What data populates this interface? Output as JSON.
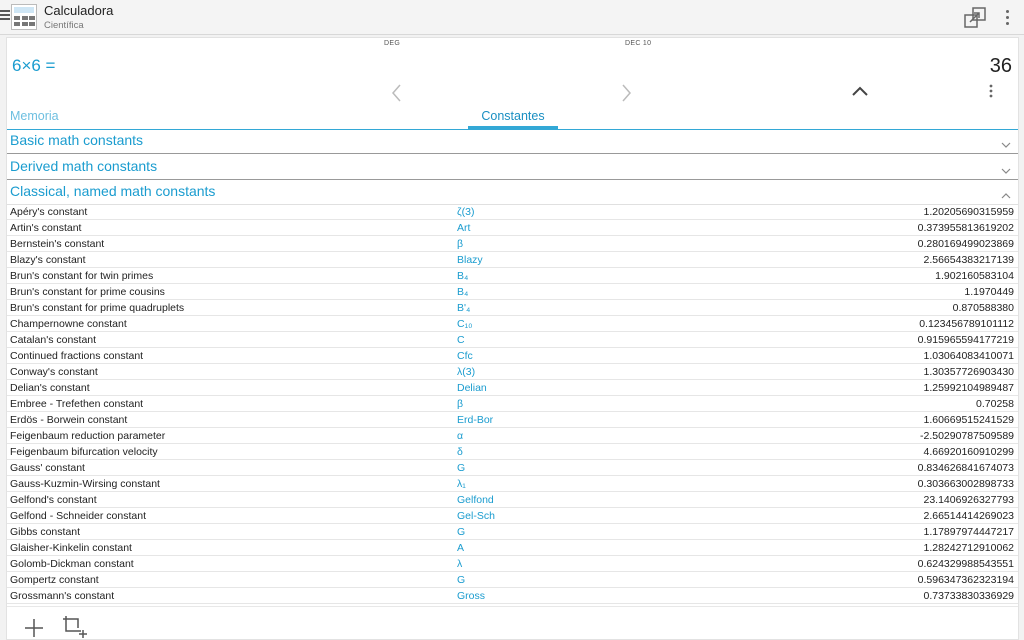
{
  "app": {
    "title": "Calculadora",
    "subtitle": "Científica"
  },
  "status": {
    "mode": "DEG",
    "memory": "DEC 10",
    "left_faint": ""
  },
  "display": {
    "expression": "6×6 =",
    "result": "36"
  },
  "tabs": {
    "memory": "Memoria",
    "constants": "Constantes",
    "active": "Constantes"
  },
  "sections": [
    {
      "label": "Basic math constants",
      "expanded": false
    },
    {
      "label": "Derived math constants",
      "expanded": false
    },
    {
      "label": "Classical, named math constants",
      "expanded": true
    }
  ],
  "constants": [
    {
      "name": "Apéry's constant",
      "symbol": "ζ(3)",
      "value": "1.20205690315959"
    },
    {
      "name": "Artin's constant",
      "symbol": "Art",
      "value": "0.373955813619202"
    },
    {
      "name": "Bernstein's constant",
      "symbol": "β",
      "value": "0.280169499023869"
    },
    {
      "name": "Blazy's constant",
      "symbol": "Blazy",
      "value": "2.56654383217139"
    },
    {
      "name": "Brun's constant for twin primes",
      "symbol": "B₄",
      "value": "1.902160583104"
    },
    {
      "name": "Brun's constant for prime cousins",
      "symbol": "B₄",
      "value": "1.1970449"
    },
    {
      "name": "Brun's constant for prime quadruplets",
      "symbol": "B'₄",
      "value": "0.870588380"
    },
    {
      "name": "Champernowne constant",
      "symbol": "C₁₀",
      "value": "0.123456789101112"
    },
    {
      "name": "Catalan's constant",
      "symbol": "C",
      "value": "0.915965594177219"
    },
    {
      "name": "Continued fractions constant",
      "symbol": "Cfc",
      "value": "1.03064083410071"
    },
    {
      "name": "Conway's constant",
      "symbol": "λ(3)",
      "value": "1.30357726903430"
    },
    {
      "name": "Delian's constant",
      "symbol": "Delian",
      "value": "1.25992104989487"
    },
    {
      "name": "Embree - Trefethen constant",
      "symbol": "β",
      "value": "0.70258"
    },
    {
      "name": "Erdös - Borwein constant",
      "symbol": "Erd-Bor",
      "value": "1.60669515241529"
    },
    {
      "name": "Feigenbaum reduction parameter",
      "symbol": "α",
      "value": "-2.50290787509589"
    },
    {
      "name": "Feigenbaum bifurcation velocity",
      "symbol": "δ",
      "value": "4.66920160910299"
    },
    {
      "name": "Gauss' constant",
      "symbol": "G",
      "value": "0.834626841674073"
    },
    {
      "name": "Gauss-Kuzmin-Wirsing constant",
      "symbol": "λ₁",
      "value": "0.303663002898733"
    },
    {
      "name": "Gelfond's constant",
      "symbol": "Gelfond",
      "value": "23.1406926327793"
    },
    {
      "name": "Gelfond - Schneider constant",
      "symbol": "Gel-Sch",
      "value": "2.66514414269023"
    },
    {
      "name": "Gibbs constant",
      "symbol": "G",
      "value": "1.17897974447217"
    },
    {
      "name": "Glaisher-Kinkelin constant",
      "symbol": "A",
      "value": "1.28242712910062"
    },
    {
      "name": "Golomb-Dickman constant",
      "symbol": "λ",
      "value": "0.624329988543551"
    },
    {
      "name": "Gompertz constant",
      "symbol": "G",
      "value": "0.596347362323194"
    },
    {
      "name": "Grossmann's constant",
      "symbol": "Gross",
      "value": "0.73733830336929"
    }
  ],
  "colors": {
    "accent": "#1a9ccf",
    "text": "#222222",
    "divider": "#e6e6e6"
  },
  "icons": {
    "menu": "hamburger-icon",
    "app": "calculator-icon",
    "window": "window-resize-icon",
    "overflow": "vertical-dots-icon",
    "prev": "chevron-left-icon",
    "next": "chevron-right-icon",
    "collapse": "chevron-up-icon",
    "add": "plus-icon",
    "add_window": "crop-add-icon"
  }
}
